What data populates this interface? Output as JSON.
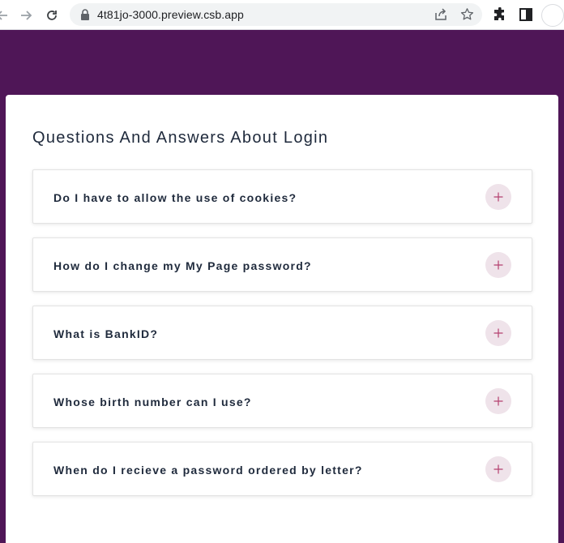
{
  "browser": {
    "url": "4t81jo-3000.preview.csb.app",
    "icons": [
      "back-icon",
      "forward-icon",
      "reload-icon",
      "lock-icon",
      "share-icon",
      "star-icon",
      "extensions-icon",
      "side-panel-icon",
      "profile-avatar"
    ]
  },
  "colors": {
    "page_background": "#4f1657",
    "card_background": "#ffffff",
    "toggle_background": "#efe3ea",
    "toggle_icon": "#b4406f",
    "text": "#1f2a3c"
  },
  "faq": {
    "title": "Questions And Answers About Login",
    "items": [
      {
        "question": "Do I have to allow the use of cookies?",
        "icon": "plus-icon"
      },
      {
        "question": "How do I change my My Page password?",
        "icon": "plus-icon"
      },
      {
        "question": "What is BankID?",
        "icon": "plus-icon"
      },
      {
        "question": "Whose birth number can I use?",
        "icon": "plus-icon"
      },
      {
        "question": "When do I recieve a password ordered by letter?",
        "icon": "plus-icon"
      }
    ]
  }
}
